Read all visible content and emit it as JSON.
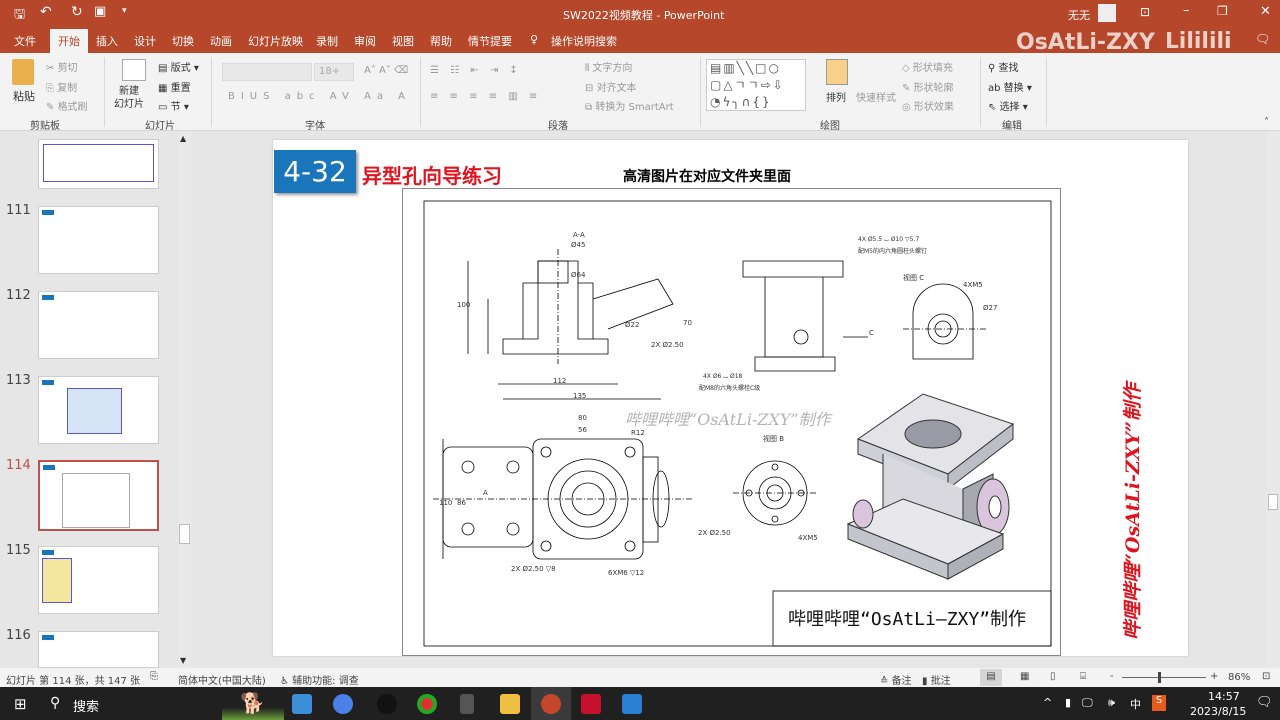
{
  "window": {
    "title": "SW2022视频教程 - PowerPoint",
    "user": "无无",
    "brand_watermark": "OsAtLi-ZXY"
  },
  "quick_access": {
    "save": "save-icon",
    "undo": "undo-icon",
    "redo": "redo-icon",
    "present": "present-icon"
  },
  "tabs": [
    "文件",
    "开始",
    "插入",
    "设计",
    "切换",
    "动画",
    "幻灯片放映",
    "录制",
    "审阅",
    "视图",
    "帮助",
    "情节提要"
  ],
  "active_tab": "开始",
  "tell_me": "操作说明搜索",
  "ribbon": {
    "clipboard": {
      "label": "剪贴板",
      "paste": "粘贴",
      "cut": "剪切",
      "copy": "复制",
      "format_painter": "格式刷"
    },
    "slides": {
      "label": "幻灯片",
      "new_slide": "新建\n幻灯片",
      "layout": "版式",
      "reset": "重置",
      "section": "节"
    },
    "font": {
      "label": "字体",
      "size": "18+"
    },
    "paragraph": {
      "label": "段落",
      "text_direction": "文字方向",
      "align_text": "对齐文本",
      "smartart": "转换为 SmartArt"
    },
    "drawing": {
      "label": "绘图",
      "arrange": "排列",
      "quick_styles": "快速样式",
      "fill": "形状填充",
      "outline": "形状轮廓",
      "effects": "形状效果"
    },
    "editing": {
      "label": "编辑",
      "find": "查找",
      "replace": "替换",
      "select": "选择"
    }
  },
  "thumbnails": [
    {
      "num": "111"
    },
    {
      "num": "112"
    },
    {
      "num": "113"
    },
    {
      "num": "114",
      "selected": true
    },
    {
      "num": "115"
    },
    {
      "num": "116"
    }
  ],
  "slide": {
    "badge": "4-32",
    "title": "异型孔向导练习",
    "subtitle": "高清图片在对应文件夹里面",
    "watermark_center": "哔哩哔哩“OsAtLi-ZXY”制作",
    "watermark_vertical": "哔哩哔哩“OsAtLi-ZXY”制作",
    "title_block": "哔哩哔哩“OsAtLi—ZXY”制作",
    "dims": {
      "section": "A-A",
      "d45": "Ø45",
      "d64": "Ø64",
      "d22": "Ø22",
      "d2_5": "2X Ø2.50",
      "w112": "112",
      "w135": "135",
      "h100": "100",
      "h70": "70",
      "w80": "80",
      "w56": "56",
      "h110": "110",
      "h86": "86",
      "view_b": "视图 B",
      "view_c": "视图 C",
      "m5": "4XM5",
      "m6": "6XM6 ▽12",
      "r12": "R12",
      "d27": "Ø27",
      "hole_note": "4X Ø5.5 ⌴ Ø10 ▽5.7",
      "hole_note2": "配M5的内六角圆柱头螺钉",
      "cb": "4X Ø6 ⌴ Ø18",
      "cb2": "配M8的六角头螺栓C级",
      "tap": "2X Ø2.50 ▽8",
      "a_label": "A",
      "c_label": "C",
      "b_label": "B"
    }
  },
  "status": {
    "slide_info": "幻灯片 第 114 张，共 147 张",
    "language": "简体中文(中国大陆)",
    "accessibility": "辅助功能: 调查",
    "notes": "备注",
    "comments": "批注",
    "zoom": "86%",
    "zoom_fraction": 0.86
  },
  "taskbar": {
    "search": "搜索",
    "time": "14:57",
    "date": "2023/8/15",
    "ime": "中"
  },
  "colors": {
    "accent": "#b7472a",
    "badge": "#1a75bb",
    "title_red": "#e0141e"
  }
}
